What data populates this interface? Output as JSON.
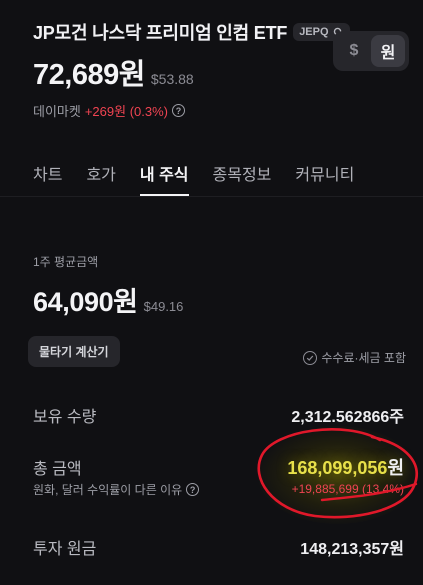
{
  "header": {
    "title": "JP모건 나스닥 프리미엄 인컴 ETF",
    "ticker": "JEPQ",
    "price_krw": "72,689원",
    "price_usd": "$53.88",
    "market": "데이마켓",
    "change": "+269원 (0.3%)"
  },
  "currency_toggle": {
    "usd": "$",
    "krw": "원",
    "selected": "원"
  },
  "tabs": [
    "차트",
    "호가",
    "내 주식",
    "종목정보",
    "커뮤니티"
  ],
  "active_tab": "내 주식",
  "holding": {
    "avg_label": "1주 평균금액",
    "avg_price": "64,090원",
    "avg_usd": "$49.16",
    "calc_button": "물타기 계산기",
    "fee_note": "수수료·세금 포함",
    "quantity_label": "보유 수량",
    "quantity_value": "2,312.562866주",
    "total_label": "총 금액",
    "total_value": "168,099,056",
    "total_unit": "원",
    "reason_text": "원화, 달러 수익률이 다른 이유",
    "gain": "+19,885,699 (13.4%)",
    "principal_label": "투자 원금",
    "principal_value": "148,213,357원"
  },
  "colors": {
    "background": "#101013",
    "up": "#f04452",
    "highlight": "#e8e04a",
    "annotation": "#e0182a"
  },
  "icons": {
    "ticker": "search-icon",
    "change_info": "info-icon",
    "fee_note": "check-circle-icon",
    "reason_info": "info-icon"
  }
}
